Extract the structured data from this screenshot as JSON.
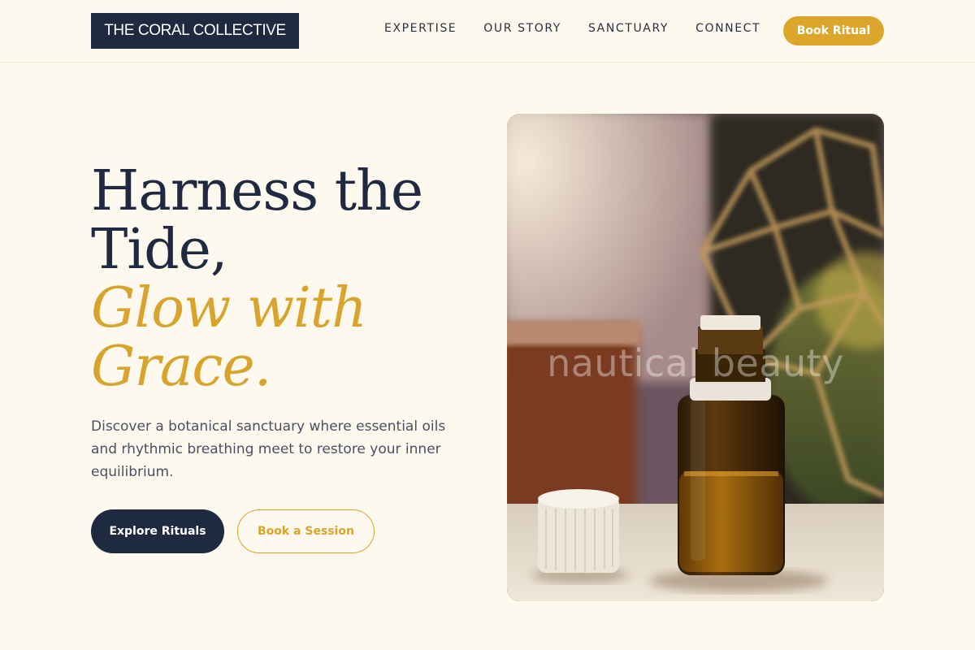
{
  "header": {
    "logo": "THE CORAL COLLECTIVE",
    "nav": [
      {
        "label": "EXPERTISE"
      },
      {
        "label": "OUR STORY"
      },
      {
        "label": "SANCTUARY"
      },
      {
        "label": "CONNECT"
      }
    ],
    "cta_label": "Book Ritual"
  },
  "hero": {
    "title_line1": "Harness the",
    "title_line2": "Tide,",
    "title_accent_line1": "Glow with",
    "title_accent_line2": "Grace.",
    "description": "Discover a botanical sanctuary where essential oils and rhythmic breathing meet to restore your inner equilibrium.",
    "primary_button": "Explore Rituals",
    "secondary_button": "Book a Session",
    "image_watermark": "nautical beauty"
  },
  "colors": {
    "background": "#fef9ee",
    "navy": "#1f2940",
    "gold": "#d8a42d"
  }
}
